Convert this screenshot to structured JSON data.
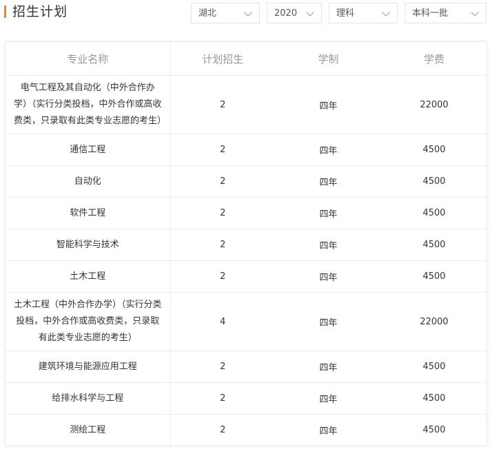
{
  "header": {
    "title": "招生计划",
    "filters": {
      "province": "湖北",
      "year": "2020",
      "subject": "理科",
      "batch": "本科一批"
    }
  },
  "table": {
    "columns": [
      "专业名称",
      "计划招生",
      "学制",
      "学费"
    ],
    "rows": [
      {
        "major": "电气工程及其自动化（中外合作办学）（实行分类投档，中外合作或高收费类，只录取有此类专业志愿的考生）",
        "plan": "2",
        "length": "四年",
        "fee": "22000"
      },
      {
        "major": "通信工程",
        "plan": "2",
        "length": "四年",
        "fee": "4500"
      },
      {
        "major": "自动化",
        "plan": "2",
        "length": "四年",
        "fee": "4500"
      },
      {
        "major": "软件工程",
        "plan": "2",
        "length": "四年",
        "fee": "4500"
      },
      {
        "major": "智能科学与技术",
        "plan": "2",
        "length": "四年",
        "fee": "4500"
      },
      {
        "major": "土木工程",
        "plan": "2",
        "length": "四年",
        "fee": "4500"
      },
      {
        "major": "土木工程（中外合作办学）（实行分类投档，中外合作或高收费类，只录取有此类专业志愿的考生）",
        "plan": "4",
        "length": "四年",
        "fee": "22000"
      },
      {
        "major": "建筑环境与能源应用工程",
        "plan": "2",
        "length": "四年",
        "fee": "4500"
      },
      {
        "major": "给排水科学与工程",
        "plan": "2",
        "length": "四年",
        "fee": "4500"
      },
      {
        "major": "测绘工程",
        "plan": "2",
        "length": "四年",
        "fee": "4500"
      }
    ]
  },
  "colors": {
    "accent": "#e58a2f",
    "border": "#ececec",
    "header_text": "#999999"
  }
}
